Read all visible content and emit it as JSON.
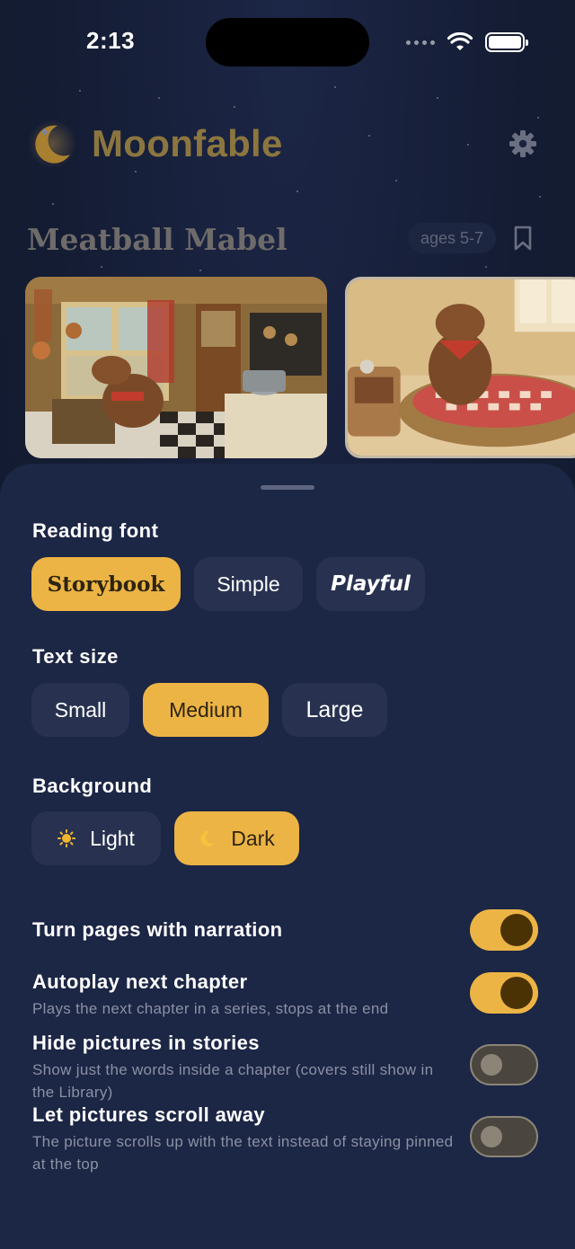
{
  "status_bar": {
    "time": "2:13"
  },
  "app": {
    "title": "Moonfable"
  },
  "story": {
    "title": "Meatball Mabel",
    "age_badge": "ages 5-7"
  },
  "settings": {
    "reading_font": {
      "label": "Reading font",
      "options": [
        "Storybook",
        "Simple",
        "Playful"
      ],
      "selected": "Storybook"
    },
    "text_size": {
      "label": "Text size",
      "options": [
        "Small",
        "Medium",
        "Large"
      ],
      "selected": "Medium"
    },
    "background": {
      "label": "Background",
      "options": [
        {
          "label": "Light",
          "icon": "sun-icon"
        },
        {
          "label": "Dark",
          "icon": "crescent-moon-icon"
        }
      ],
      "selected": "Dark"
    },
    "toggles": [
      {
        "title": "Turn pages with narration",
        "description": "",
        "on": true
      },
      {
        "title": "Autoplay next chapter",
        "description": "Plays the next chapter in a series, stops at the end",
        "on": true
      },
      {
        "title": "Hide pictures in stories",
        "description": "Show just the words inside a chapter (covers still show in the Library)",
        "on": false
      },
      {
        "title": "Let pictures scroll away",
        "description": "The picture scrolls up with the text instead of staying pinned at the top",
        "on": false
      }
    ]
  },
  "colors": {
    "sheet_bg": "#1c2645",
    "accent": "#ecb445",
    "chip_bg": "#283250",
    "app_bg": "#141c33"
  }
}
